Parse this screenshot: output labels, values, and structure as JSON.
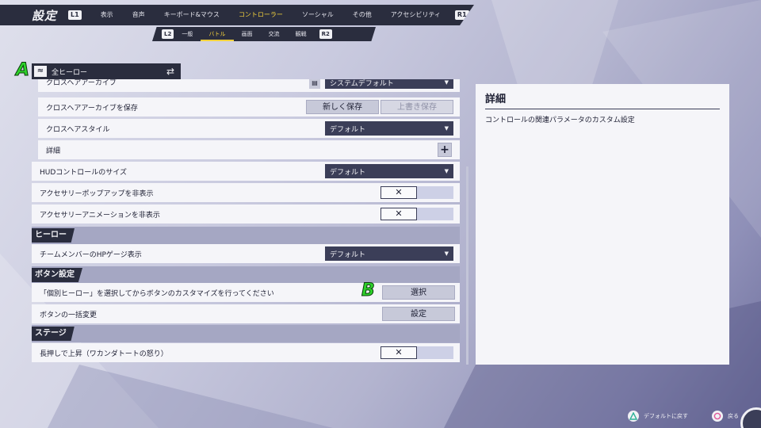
{
  "topnav": {
    "title": "設定",
    "left_tag": "L1",
    "right_tag": "R1",
    "tabs": [
      "表示",
      "音声",
      "キーボード&マウス",
      "コントローラー",
      "ソーシャル",
      "その他",
      "アクセシビリティ"
    ],
    "active_tab": "コントローラー"
  },
  "subnav": {
    "left_tag": "L2",
    "right_tag": "R2",
    "tabs": [
      "一般",
      "バトル",
      "画面",
      "交流",
      "観戦"
    ],
    "active_tab": "バトル"
  },
  "markers": {
    "a": "A",
    "b": "B"
  },
  "hero_selector": {
    "value": "全ヒーロー"
  },
  "settings": {
    "crosshair_archive": {
      "label": "クロスヘアアーカイブ",
      "value": "システムデフォルト"
    },
    "save_archive": {
      "label": "クロスヘアアーカイブを保存",
      "new_save": "新しく保存",
      "overwrite": "上書き保存"
    },
    "crosshair_style": {
      "label": "クロスヘアスタイル",
      "value": "デフォルト"
    },
    "details": {
      "label": "詳細",
      "icon": "plus-icon"
    },
    "hud_size": {
      "label": "HUDコントロールのサイズ",
      "value": "デフォルト"
    },
    "accessory_popup": {
      "label": "アクセサリーポップアップを非表示",
      "state": "✕"
    },
    "accessory_anim": {
      "label": "アクセサリーアニメーションを非表示",
      "state": "✕"
    },
    "hero_section": {
      "title": "ヒーロー"
    },
    "team_hp": {
      "label": "チームメンバーのHPゲージ表示",
      "value": "デフォルト"
    },
    "button_section": {
      "title": "ボタン設定"
    },
    "per_hero": {
      "label": "「個別ヒーロー」を選択してからボタンのカスタマイズを行ってください",
      "button": "選択"
    },
    "bulk_change": {
      "label": "ボタンの一括変更",
      "button": "設定"
    },
    "stage_section": {
      "title": "ステージ"
    },
    "hold_rise": {
      "label": "長押しで上昇（ワカンダトートの怒り）",
      "state": "✕"
    }
  },
  "detail": {
    "title": "詳細",
    "body": "コントロールの関連パラメータのカスタム設定"
  },
  "footer": {
    "default_hint": "デフォルトに戻す",
    "back_hint": "戻る"
  },
  "colors": {
    "accent": "#f4d23c",
    "dark": "#2a2d3e",
    "marker": "#2dd12a"
  }
}
